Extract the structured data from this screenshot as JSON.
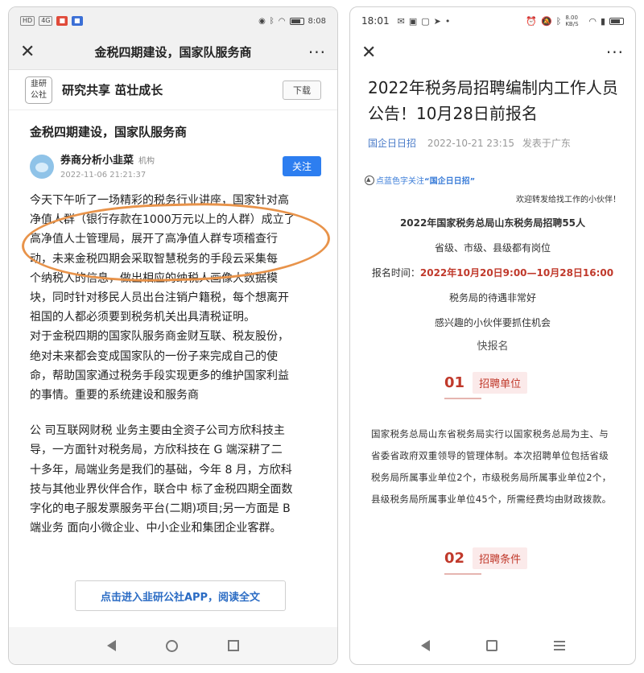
{
  "left": {
    "status": {
      "time": "8:08",
      "signal_label": "HD",
      "badge1": "4G"
    },
    "title": "金税四期建设，国家队服务商",
    "banner": {
      "logo_line1": "韭研",
      "logo_line2": "公社",
      "slogan": "研究共享 茁壮成长",
      "download": "下载"
    },
    "article": {
      "title": "金税四期建设，国家队服务商",
      "author": "券商分析小韭菜",
      "author_tag": "机构",
      "date": "2022-11-06 21:21:37",
      "follow": "关注",
      "lines": [
        "今天下午听了一场精彩的税务行业讲座，国家针对高",
        "净值人群（银行存款在1000万元以上的人群）成立了",
        "高净值人士管理局，展开了高净值人群专项稽查行",
        "动，未来金税四期会采取智慧税务的手段云采集每",
        "个纳税人的信息，做出相应的纳税人画像大数据模",
        "块，同时针对移民人员出台注销户籍税，每个想离开",
        "祖国的人都必须要到税务机关出具清税证明。",
        "对于金税四期的国家队服务商金财互联、税友股份，",
        "绝对未来都会变成国家队的一份子来完成自己的使",
        "命，帮助国家通过税务手段实现更多的维护国家利益",
        "的事情。重要的系统建设和服务商"
      ],
      "lines2": [
        "公 司互联网财税 业务主要由全资子公司方欣科技主",
        "导，一方面针对税务局，方欣科技在 G 端深耕了二",
        "十多年，局端业务是我们的基础，今年 8 月，方欣科",
        "技与其他业界伙伴合作，联合中 标了金税四期全面数",
        "字化的电子服发票服务平台(二期)项目;另一方面是 B",
        "端业务 面向小微企业、中小企业和集团企业客群。"
      ],
      "read_more": "点击进入韭研公社APP，阅读全文"
    }
  },
  "right": {
    "status": {
      "time": "18:01",
      "net_speed": "8.00 KB/S"
    },
    "title": "2022年税务局招聘编制内工作人员公告！10月28日前报名",
    "meta": {
      "source": "国企日日招",
      "date": "2022-10-21 23:15",
      "location": "发表于广东"
    },
    "follow_prefix": "点蓝色字关注",
    "follow_name": "“国企日日招”",
    "welcome": "欢迎转发给找工作的小伙伴！",
    "headline": "2022年国家税务总局山东税务局招聘55人",
    "posts": "省级、市级、县级都有岗位",
    "time_label": "报名时间：",
    "time_value": "2022年10月20日9:00—10月28日16:00",
    "treatment": "税务局的待遇非常好",
    "interest": "感兴趣的小伙伴要抓住机会",
    "quick": "快报名",
    "section1": {
      "num": "01",
      "label": "招聘单位"
    },
    "para1": "国家税务总局山东省税务局实行以国家税务总局为主、与省委省政府双重领导的管理体制。本次招聘单位包括省级税务局所属事业单位2个，市级税务局所属事业单位2个，县级税务局所属事业单位45个，所需经费均由财政拨款。",
    "section2": {
      "num": "02",
      "label": "招聘条件"
    }
  }
}
